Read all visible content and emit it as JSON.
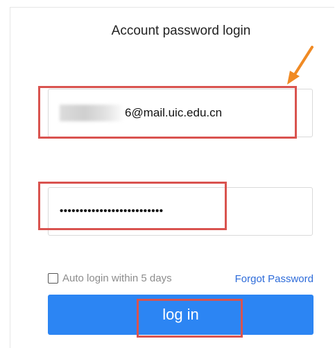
{
  "login": {
    "title": "Account password login",
    "email_value": "6@mail.uic.edu.cn",
    "password_mask": "••••••••••••••••••••••••••",
    "auto_login_label": "Auto login within 5 days",
    "forgot_label": "Forgot Password",
    "login_label": "log in"
  },
  "colors": {
    "primary_button": "#2c85f3",
    "link": "#2d6bd9",
    "highlight_box": "#d9534f",
    "arrow": "#f08a24"
  },
  "icons": {
    "annotation_arrow": "arrow-icon",
    "checkbox": "checkbox-icon"
  }
}
